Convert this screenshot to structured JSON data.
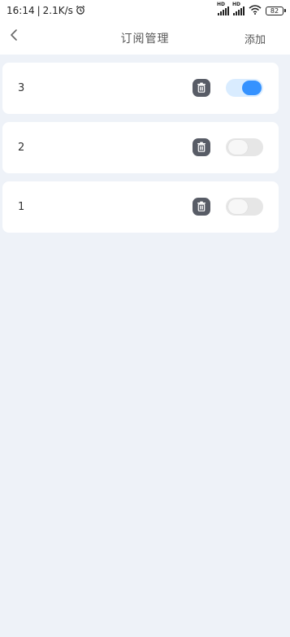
{
  "status_bar": {
    "time": "16:14",
    "separator": "|",
    "speed": "2.1K/s",
    "alarm_icon": "alarm-clock-icon",
    "signal_1_label": "HD",
    "signal_2_label": "HD",
    "wifi_icon": "wifi-icon",
    "battery_level": "82"
  },
  "nav": {
    "back_icon": "chevron-left-icon",
    "title": "订阅管理",
    "add_label": "添加"
  },
  "subscriptions": [
    {
      "label": "3",
      "enabled": true
    },
    {
      "label": "2",
      "enabled": false
    },
    {
      "label": "1",
      "enabled": false
    }
  ],
  "colors": {
    "background": "#eef2f8",
    "card": "#ffffff",
    "toggle_on": "#3592ff",
    "toggle_on_track": "#d9ecff",
    "toggle_off_track": "#e6e6e6",
    "delete_button": "#585c66"
  }
}
